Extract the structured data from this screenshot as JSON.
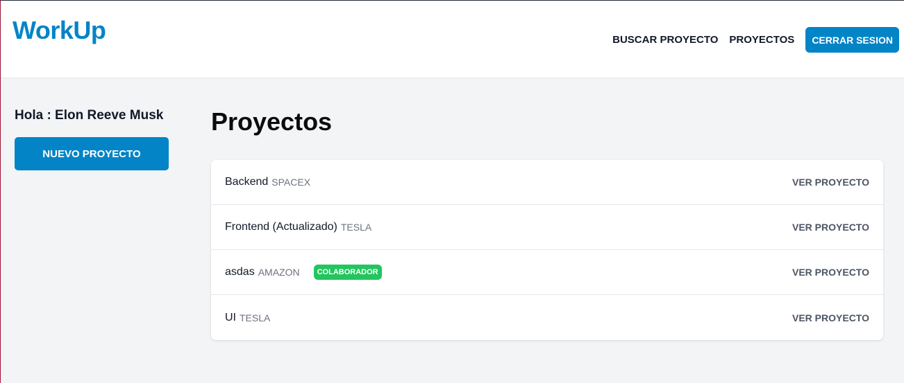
{
  "header": {
    "logo": "WorkUp",
    "nav": {
      "search_project": "BUSCAR PROYECTO",
      "projects": "PROYECTOS",
      "logout": "CERRAR SESION"
    }
  },
  "sidebar": {
    "greeting": "Hola : Elon Reeve Musk",
    "new_project_button": "NUEVO PROYECTO"
  },
  "main": {
    "title": "Proyectos",
    "projects": [
      {
        "name": "Backend",
        "company": "SPACEX",
        "badge": "",
        "action": "VER PROYECTO"
      },
      {
        "name": "Frontend (Actualizado)",
        "company": "TESLA",
        "badge": "",
        "action": "VER PROYECTO"
      },
      {
        "name": "asdas",
        "company": "AMAZON",
        "badge": "COLABORADOR",
        "action": "VER PROYECTO"
      },
      {
        "name": "UI",
        "company": "TESLA",
        "badge": "",
        "action": "VER PROYECTO"
      }
    ]
  },
  "colors": {
    "brand": "#0284c7",
    "badge": "#22c55e",
    "background": "#f3f4f6"
  }
}
